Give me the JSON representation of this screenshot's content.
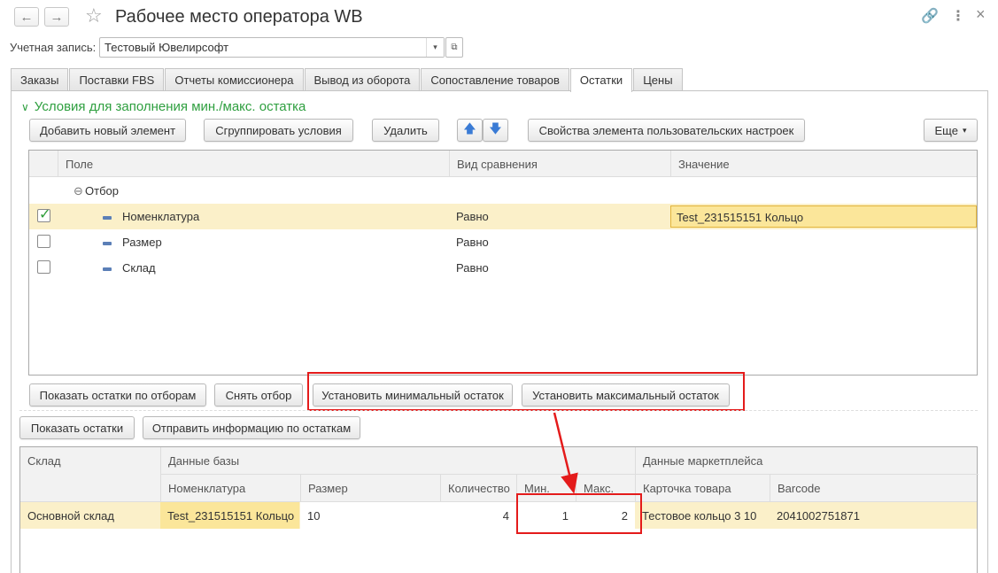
{
  "window": {
    "title": "Рабочее место оператора WB",
    "back": "←",
    "forward": "→",
    "star": "☆",
    "link_icon": "🔗",
    "more_icon": "⋮",
    "close_icon": "×"
  },
  "account": {
    "label": "Учетная запись:",
    "value": "Тестовый Ювелирсофт",
    "drop": "▾",
    "open": "⧉"
  },
  "tabs": [
    {
      "label": "Заказы"
    },
    {
      "label": "Поставки FBS"
    },
    {
      "label": "Отчеты комиссионера"
    },
    {
      "label": "Вывод из оборота"
    },
    {
      "label": "Сопоставление товаров"
    },
    {
      "label": "Остатки",
      "active": true
    },
    {
      "label": "Цены"
    }
  ],
  "conditions": {
    "title": "Условия для заполнения мин./макс. остатка",
    "chevron": "∨",
    "toolbar": {
      "add": "Добавить новый элемент",
      "group": "Сгруппировать условия",
      "delete": "Удалить",
      "up": "🡅",
      "down": "🡇",
      "props": "Свойства элемента пользовательских настроек",
      "more": "Еще",
      "more_arrow": "▾"
    },
    "columns": [
      "Поле",
      "Вид сравнения",
      "Значение"
    ],
    "group_row": {
      "toggle": "⊖",
      "label": "Отбор"
    },
    "rows": [
      {
        "checked": true,
        "field": "Номенклатура",
        "comparison": "Равно",
        "value": "Test_231515151 Кольцо"
      },
      {
        "checked": false,
        "field": "Размер",
        "comparison": "Равно",
        "value": ""
      },
      {
        "checked": false,
        "field": "Склад",
        "comparison": "Равно",
        "value": ""
      }
    ]
  },
  "actions": {
    "show_by_filters": "Показать остатки по отборам",
    "clear_filter": "Снять отбор",
    "set_min": "Установить минимальный остаток",
    "set_max": "Установить максимальный остаток",
    "show_stock": "Показать остатки",
    "send_stock": "Отправить информацию по остаткам"
  },
  "stock_table": {
    "group_headers": [
      "Склад",
      "Данные базы",
      "Данные маркетплейса"
    ],
    "columns": [
      "Номенклатура",
      "Размер",
      "Количество",
      "Мин.",
      "Макс.",
      "Карточка товара",
      "Barcode"
    ],
    "rows": [
      {
        "warehouse": "Основной склад",
        "nomenclature": "Test_231515151 Кольцо",
        "size": "10",
        "quantity": "4",
        "min": "1",
        "max": "2",
        "card": "Тестовое кольцо 3 10",
        "barcode": "2041002751871"
      }
    ]
  },
  "colors": {
    "accent_green": "#2e9f3f",
    "selection": "#fbf0c9",
    "highlight": "#fbe69a",
    "annotation_red": "#e41b1b"
  }
}
